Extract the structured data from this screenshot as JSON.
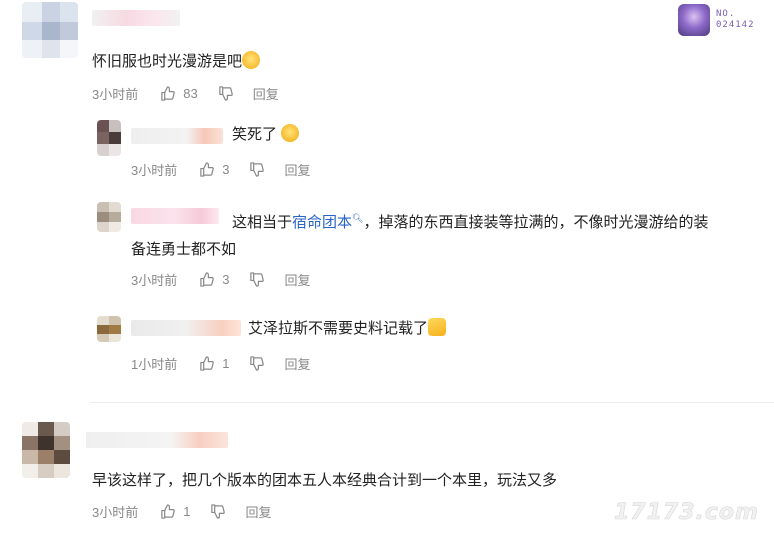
{
  "badge": {
    "label": "NO.",
    "number": "024142"
  },
  "watermark": "17173.com",
  "comments": [
    {
      "text": "怀旧服也时光漫游是吧",
      "time": "3小时前",
      "likes": "83",
      "reply_label": "回复"
    },
    {
      "text": "笑死了",
      "time": "3小时前",
      "likes": "3",
      "reply_label": "回复"
    },
    {
      "text_before": "这相当于",
      "link": "宿命团本",
      "text_after": "，掉落的东西直接装等拉满的，不像时光漫游给的装",
      "text_line2": "备连勇士都不如",
      "time": "3小时前",
      "likes": "3",
      "reply_label": "回复"
    },
    {
      "text": "艾泽拉斯不需要史料记载了",
      "time": "1小时前",
      "likes": "1",
      "reply_label": "回复"
    },
    {
      "text": "早该这样了，把几个版本的团本五人本经典合计到一个本里，玩法又多",
      "time": "3小时前",
      "likes": "1",
      "reply_label": "回复"
    }
  ]
}
